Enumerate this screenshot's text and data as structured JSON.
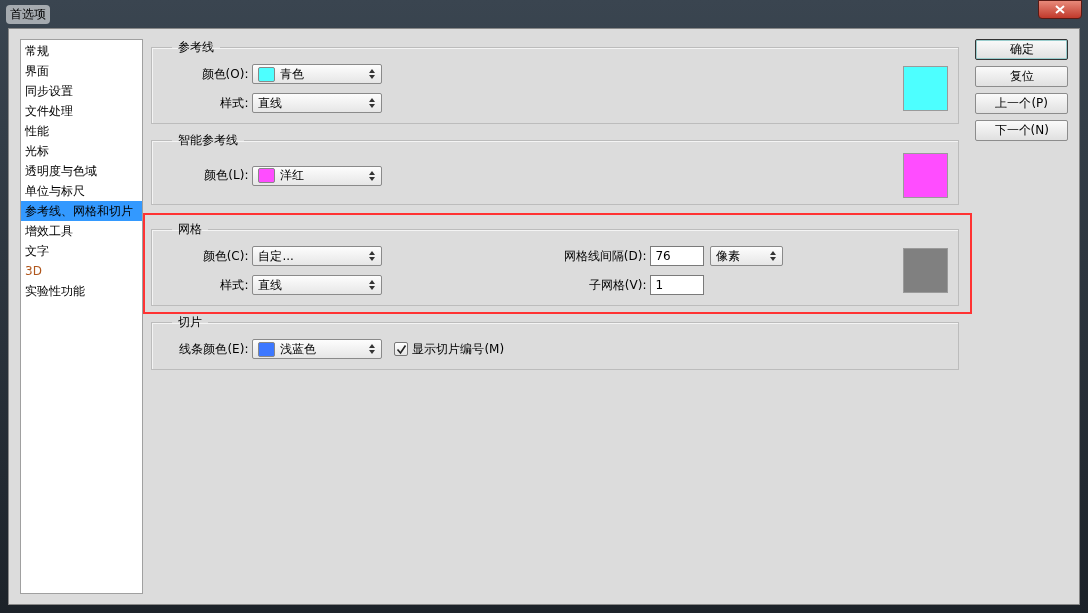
{
  "window": {
    "title": "首选项"
  },
  "sidebar": {
    "items": [
      {
        "label": "常规",
        "selected": false
      },
      {
        "label": "界面",
        "selected": false
      },
      {
        "label": "同步设置",
        "selected": false
      },
      {
        "label": "文件处理",
        "selected": false
      },
      {
        "label": "性能",
        "selected": false
      },
      {
        "label": "光标",
        "selected": false
      },
      {
        "label": "透明度与色域",
        "selected": false
      },
      {
        "label": "单位与标尺",
        "selected": false
      },
      {
        "label": "参考线、网格和切片",
        "selected": true
      },
      {
        "label": "增效工具",
        "selected": false
      },
      {
        "label": "文字",
        "selected": false
      },
      {
        "label": "3D",
        "selected": false,
        "color": "#b0561c"
      },
      {
        "label": "实验性功能",
        "selected": false
      }
    ]
  },
  "sections": [
    {
      "title": "参考线",
      "highlighted": false,
      "preview": {
        "color": "#4dffff"
      },
      "rows": [
        [
          {
            "kind": "select",
            "label": "颜色(O):",
            "value": "青色",
            "swatch": {
              "color": "#4dffff"
            }
          }
        ],
        [
          {
            "kind": "select",
            "label": "样式:",
            "value": "直线"
          }
        ]
      ]
    },
    {
      "title": "智能参考线",
      "highlighted": false,
      "preview": {
        "color": "#ff4dff"
      },
      "rows": [
        [
          {
            "kind": "select",
            "label": "颜色(L):",
            "value": "洋红",
            "swatch": {
              "color": "#ff4dff"
            }
          }
        ]
      ]
    },
    {
      "title": "网格",
      "highlighted": true,
      "preview": {
        "color": "#808080"
      },
      "rows": [
        [
          {
            "kind": "select",
            "label": "颜色(C):",
            "value": "自定..."
          },
          {
            "kind": "input",
            "label": "网格线间隔(D):",
            "value": "76",
            "unit": "像素"
          }
        ],
        [
          {
            "kind": "select",
            "label": "样式:",
            "value": "直线"
          },
          {
            "kind": "input",
            "label": "子网格(V):",
            "value": "1"
          }
        ]
      ]
    },
    {
      "title": "切片",
      "highlighted": false,
      "rows": [
        [
          {
            "kind": "select",
            "label": "线条颜色(E):",
            "value": "浅蓝色",
            "swatch": {
              "color": "#3d78ff"
            }
          },
          {
            "kind": "checkbox",
            "label": "显示切片编号(M)",
            "checked": true
          }
        ]
      ]
    }
  ],
  "buttons": [
    {
      "label": "确定",
      "default": true
    },
    {
      "label": "复位",
      "default": false
    },
    {
      "label": "上一个(P)",
      "default": false
    },
    {
      "label": "下一个(N)",
      "default": false
    }
  ]
}
